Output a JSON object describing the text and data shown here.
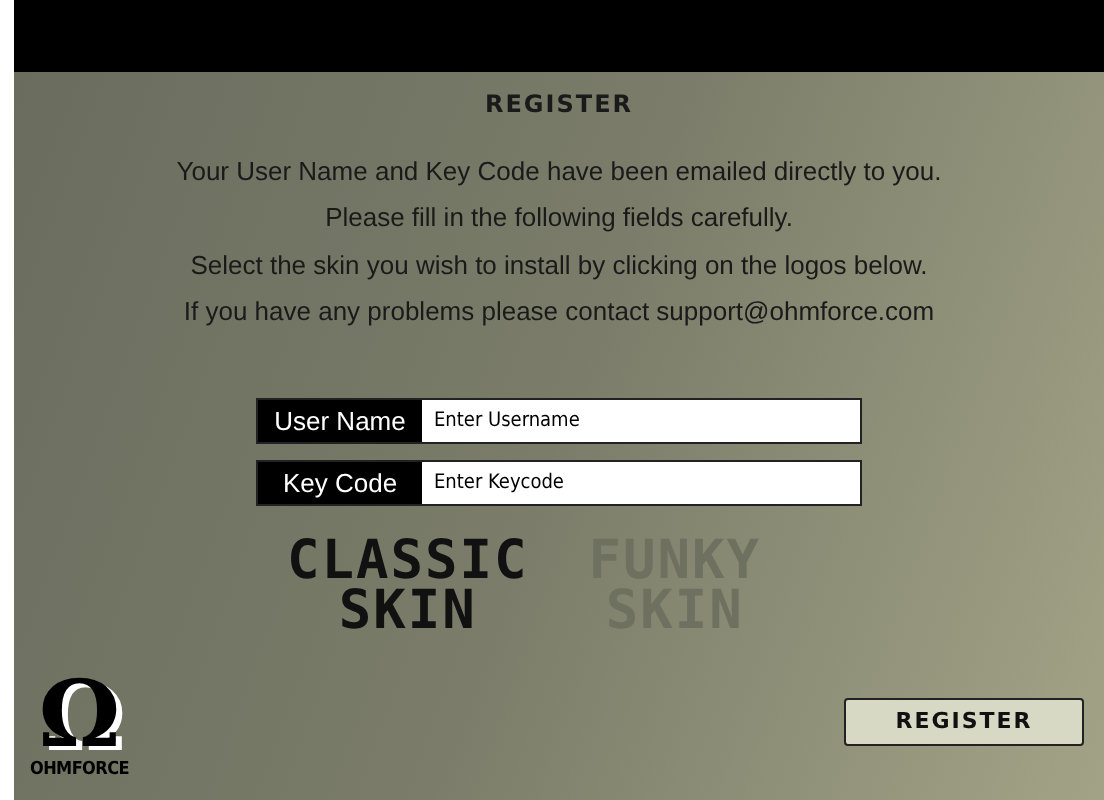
{
  "title": "REGISTER",
  "instructions": [
    "Your User Name and Key Code have been emailed directly to you.",
    "Please fill in the following fields carefully.",
    "Select the skin you wish to install by clicking on the logos below.",
    "If you have any problems please contact support@ohmforce.com"
  ],
  "fields": [
    {
      "label": "User Name",
      "placeholder": "Enter Username"
    },
    {
      "label": "Key Code",
      "placeholder": "Enter Keycode"
    }
  ],
  "skins": [
    {
      "label": "CLASSIC",
      "sublabel": "SKIN",
      "selected": true
    },
    {
      "label": "FUNKY",
      "sublabel": "SKIN",
      "selected": false
    }
  ],
  "logo": {
    "symbol": "Ω",
    "name": "OHMFORCE"
  },
  "button": "REGISTER"
}
